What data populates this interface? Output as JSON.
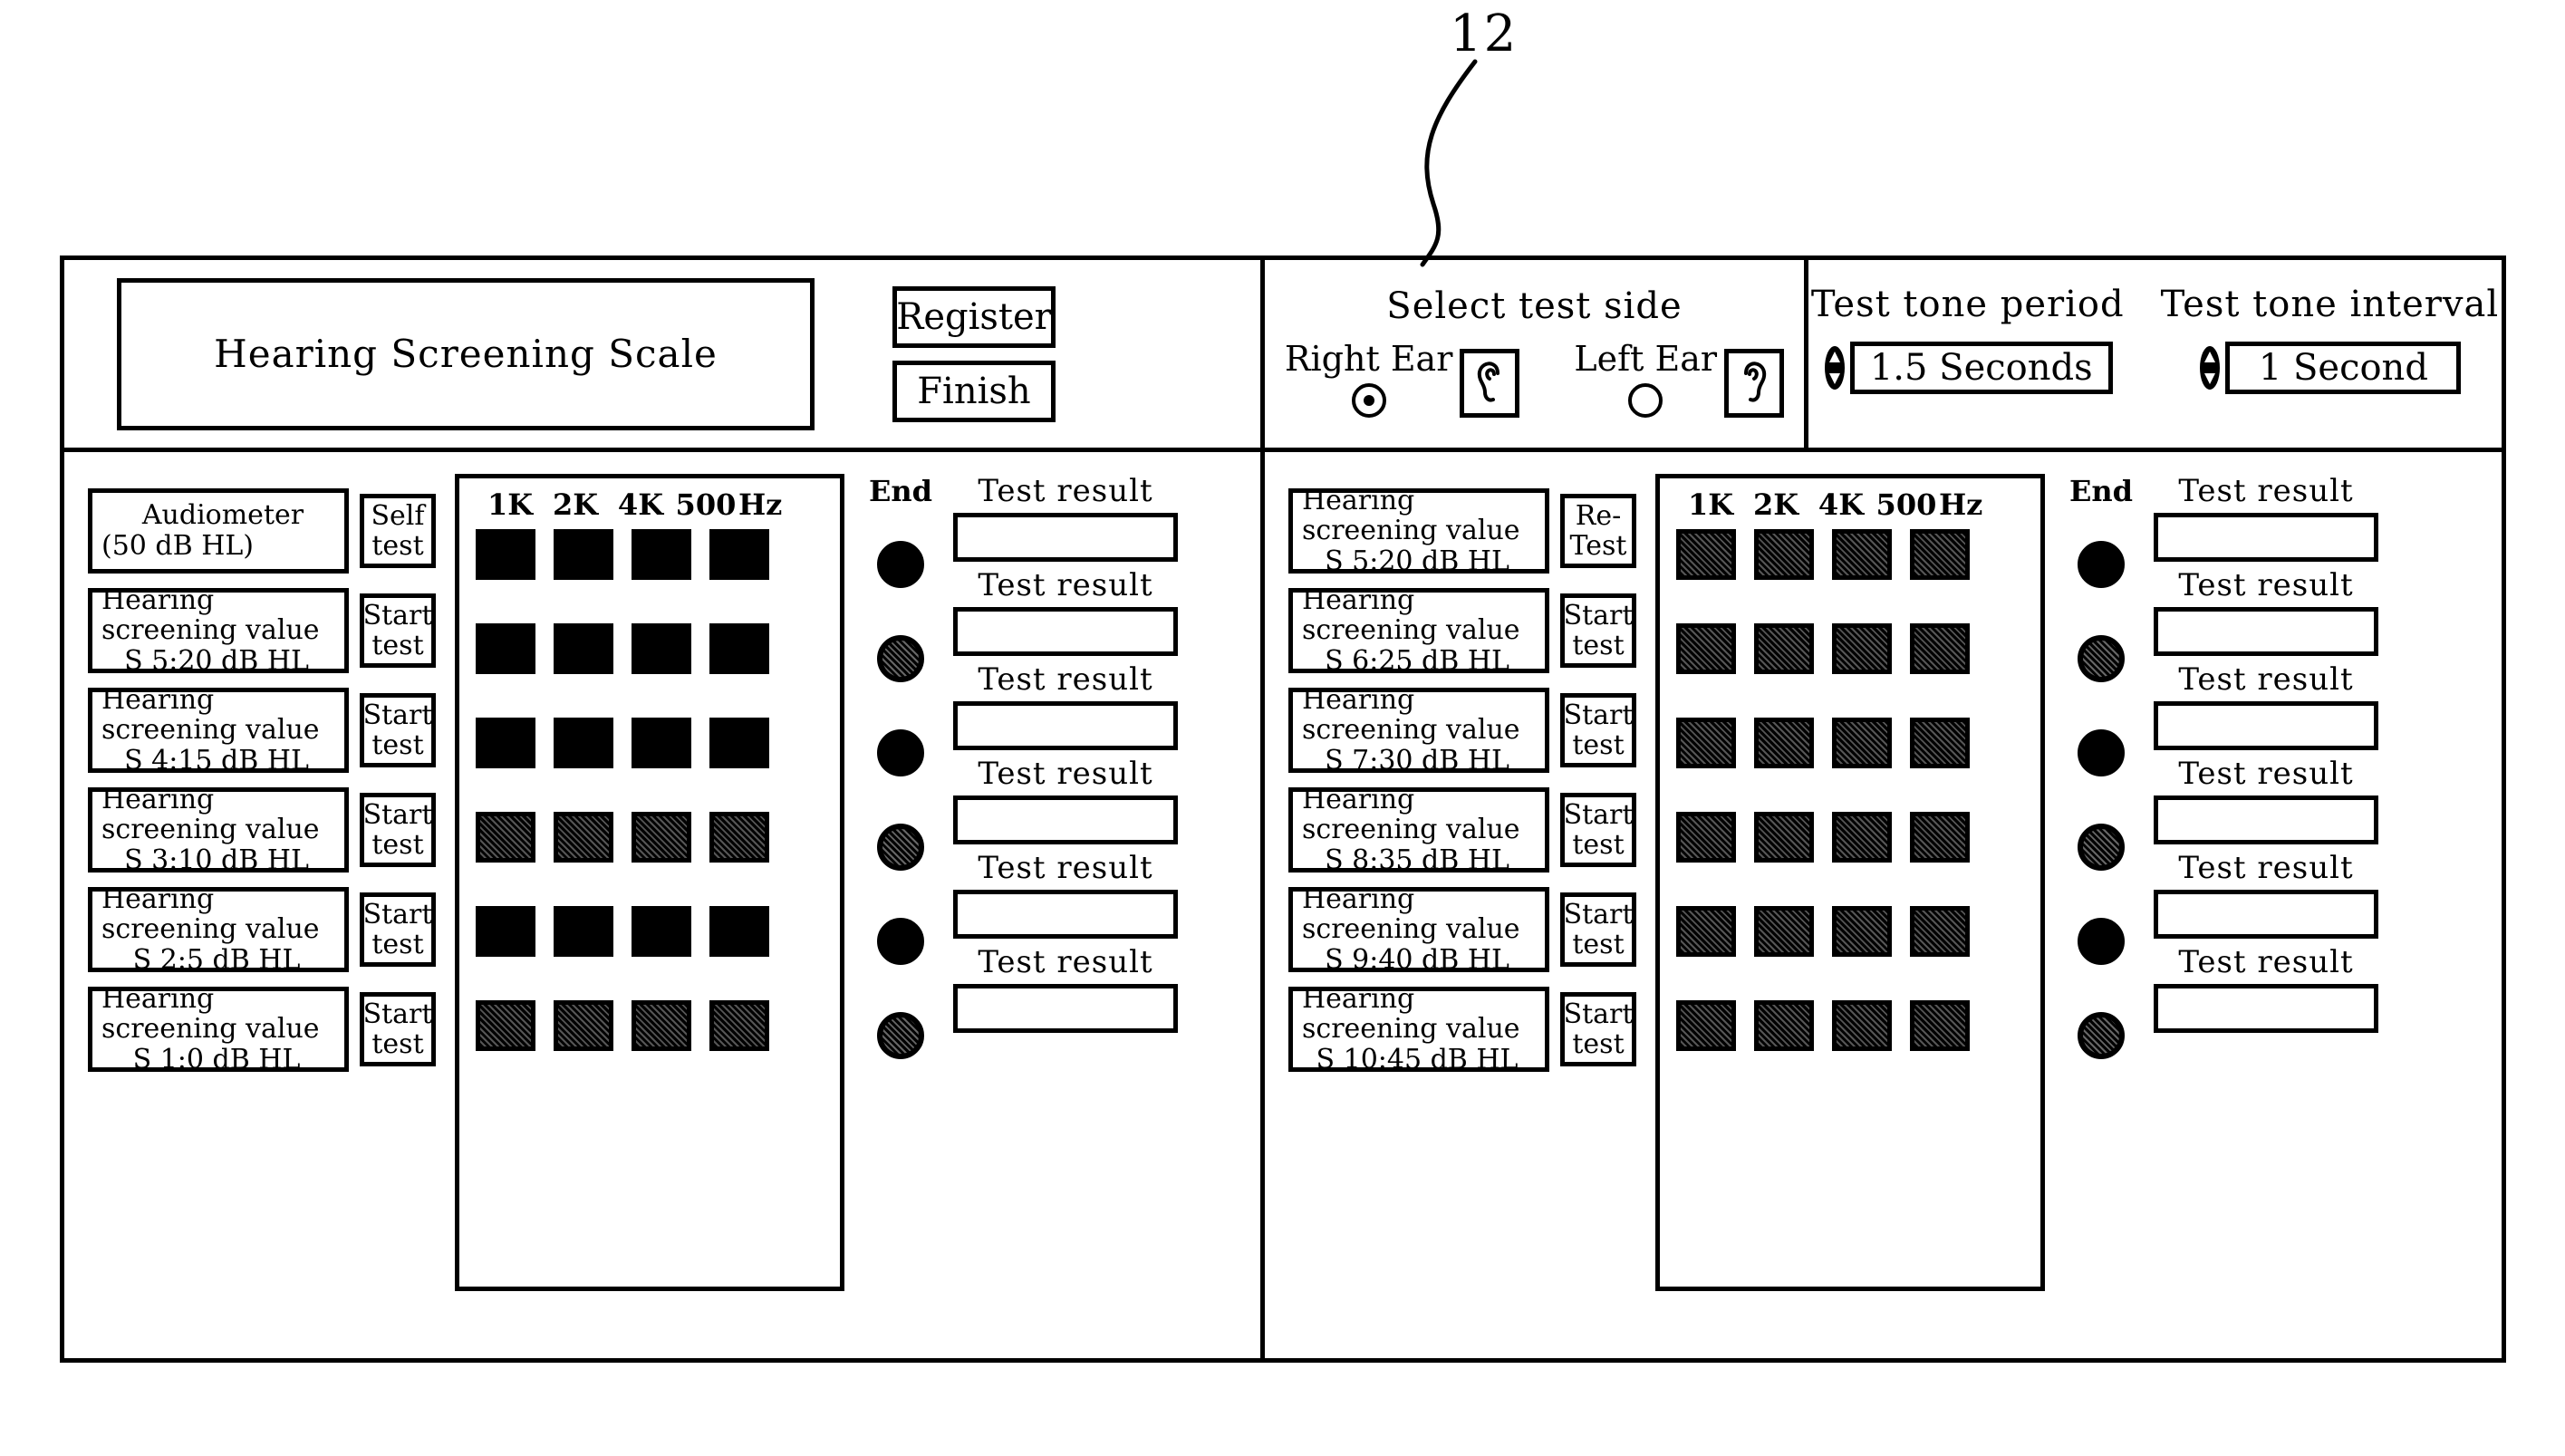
{
  "figure": {
    "reference_numeral": "12"
  },
  "header": {
    "title": "Hearing Screening Scale",
    "buttons": [
      {
        "label": "Register",
        "name": "register-button"
      },
      {
        "label": "Finish",
        "name": "finish-button"
      }
    ],
    "select_test_side": {
      "title": "Select test side",
      "right_ear": {
        "label": "Right Ear",
        "selected": true,
        "icon": "right-ear-icon"
      },
      "left_ear": {
        "label": "Left Ear",
        "selected": false,
        "icon": "left-ear-icon"
      }
    },
    "tone_settings": [
      {
        "label": "Test tone period",
        "value": "1.5 Seconds",
        "spinner": "updown-spinner-icon"
      },
      {
        "label": "Test tone interval",
        "value": "1 Second",
        "spinner": "updown-spinner-icon"
      }
    ]
  },
  "grid": {
    "frequency_headers": [
      "1K",
      "2K",
      "4K",
      "500",
      "Hz"
    ],
    "end_label": "End",
    "result_label": "Test result",
    "result_value": ""
  },
  "left_panel": {
    "rows": [
      {
        "line1": "Audiometer",
        "line2": "(50 dB HL)",
        "line3": "",
        "button": "Self\ntest",
        "button_label_1": "Self",
        "button_label_2": "test",
        "single": true
      },
      {
        "line1": "Hearing",
        "line2": "screening value",
        "line3": "S 5:20 dB HL",
        "button_label_1": "Start",
        "button_label_2": "test",
        "single": false
      },
      {
        "line1": "Hearing",
        "line2": "screening value",
        "line3": "S 4:15 dB HL",
        "button_label_1": "Start",
        "button_label_2": "test",
        "single": false
      },
      {
        "line1": "Hearing",
        "line2": "screening value",
        "line3": "S 3:10 dB HL",
        "button_label_1": "Start",
        "button_label_2": "test",
        "single": false
      },
      {
        "line1": "Hearing",
        "line2": "screening value",
        "line3": "S 2:5 dB HL",
        "button_label_1": "Start",
        "button_label_2": "test",
        "single": false
      },
      {
        "line1": "Hearing",
        "line2": "screening value",
        "line3": "S 1:0 dB HL",
        "button_label_1": "Start",
        "button_label_2": "test",
        "single": false
      }
    ]
  },
  "right_panel": {
    "rows": [
      {
        "line1": "Hearing",
        "line2": "screening value",
        "line3": "S 5:20 dB HL",
        "button_label_1": "Re-",
        "button_label_2": "Test",
        "single": false
      },
      {
        "line1": "Hearing",
        "line2": "screening value",
        "line3": "S 6:25 dB HL",
        "button_label_1": "Start",
        "button_label_2": "test",
        "single": false
      },
      {
        "line1": "Hearing",
        "line2": "screening value",
        "line3": "S 7:30 dB HL",
        "button_label_1": "Start",
        "button_label_2": "test",
        "single": false
      },
      {
        "line1": "Hearing",
        "line2": "screening value",
        "line3": "S 8:35 dB HL",
        "button_label_1": "Start",
        "button_label_2": "test",
        "single": false
      },
      {
        "line1": "Hearing",
        "line2": "screening value",
        "line3": "S 9:40 dB HL",
        "button_label_1": "Start",
        "button_label_2": "test",
        "single": false
      },
      {
        "line1": "Hearing",
        "line2": "screening value",
        "line3": "S 10:45 dB HL",
        "button_label_1": "Start",
        "button_label_2": "test",
        "single": false
      }
    ]
  },
  "colors": {
    "ink": "#000000",
    "paper": "#ffffff"
  }
}
